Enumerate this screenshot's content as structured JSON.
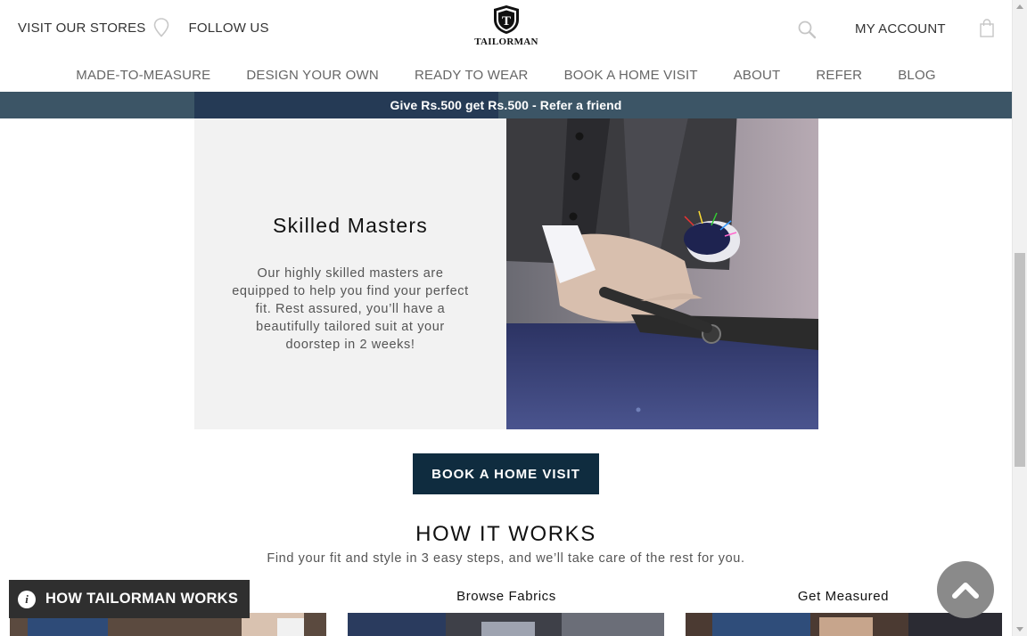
{
  "header": {
    "visit_stores": "VISIT OUR STORES",
    "follow_us": "FOLLOW US",
    "brand": "TAILORMAN",
    "logo_letter": "T",
    "my_account": "MY ACCOUNT"
  },
  "nav": {
    "items": [
      {
        "label": "MADE-TO-MEASURE"
      },
      {
        "label": "DESIGN YOUR OWN"
      },
      {
        "label": "READY TO WEAR"
      },
      {
        "label": "BOOK A HOME VISIT"
      },
      {
        "label": "ABOUT"
      },
      {
        "label": "REFER"
      },
      {
        "label": "BLOG"
      }
    ]
  },
  "promo": {
    "text": "Give Rs.500 get Rs.500 - Refer a friend"
  },
  "feature": {
    "title": "Skilled Masters",
    "description": "Our highly skilled masters are equipped to help you find your perfect fit. Rest assured, you’ll have a beautifully tailored suit at your doorstep in 2 weeks!"
  },
  "cta": {
    "label": "BOOK A HOME VISIT"
  },
  "how_it_works": {
    "title": "HOW IT WORKS",
    "subtitle": "Find your fit and style in 3 easy steps, and we’ll take care of the rest for you.",
    "steps": [
      {
        "label": ""
      },
      {
        "label": "Browse Fabrics"
      },
      {
        "label": "Get Measured"
      }
    ]
  },
  "floating": {
    "how_works_label": "HOW TAILORMAN WORKS",
    "info_glyph": "i"
  },
  "colors": {
    "promo_bar": "#3c5566",
    "cta": "#0f2c3f",
    "panel": "#f2f2f2",
    "floating_button": "#2f2f2f"
  }
}
